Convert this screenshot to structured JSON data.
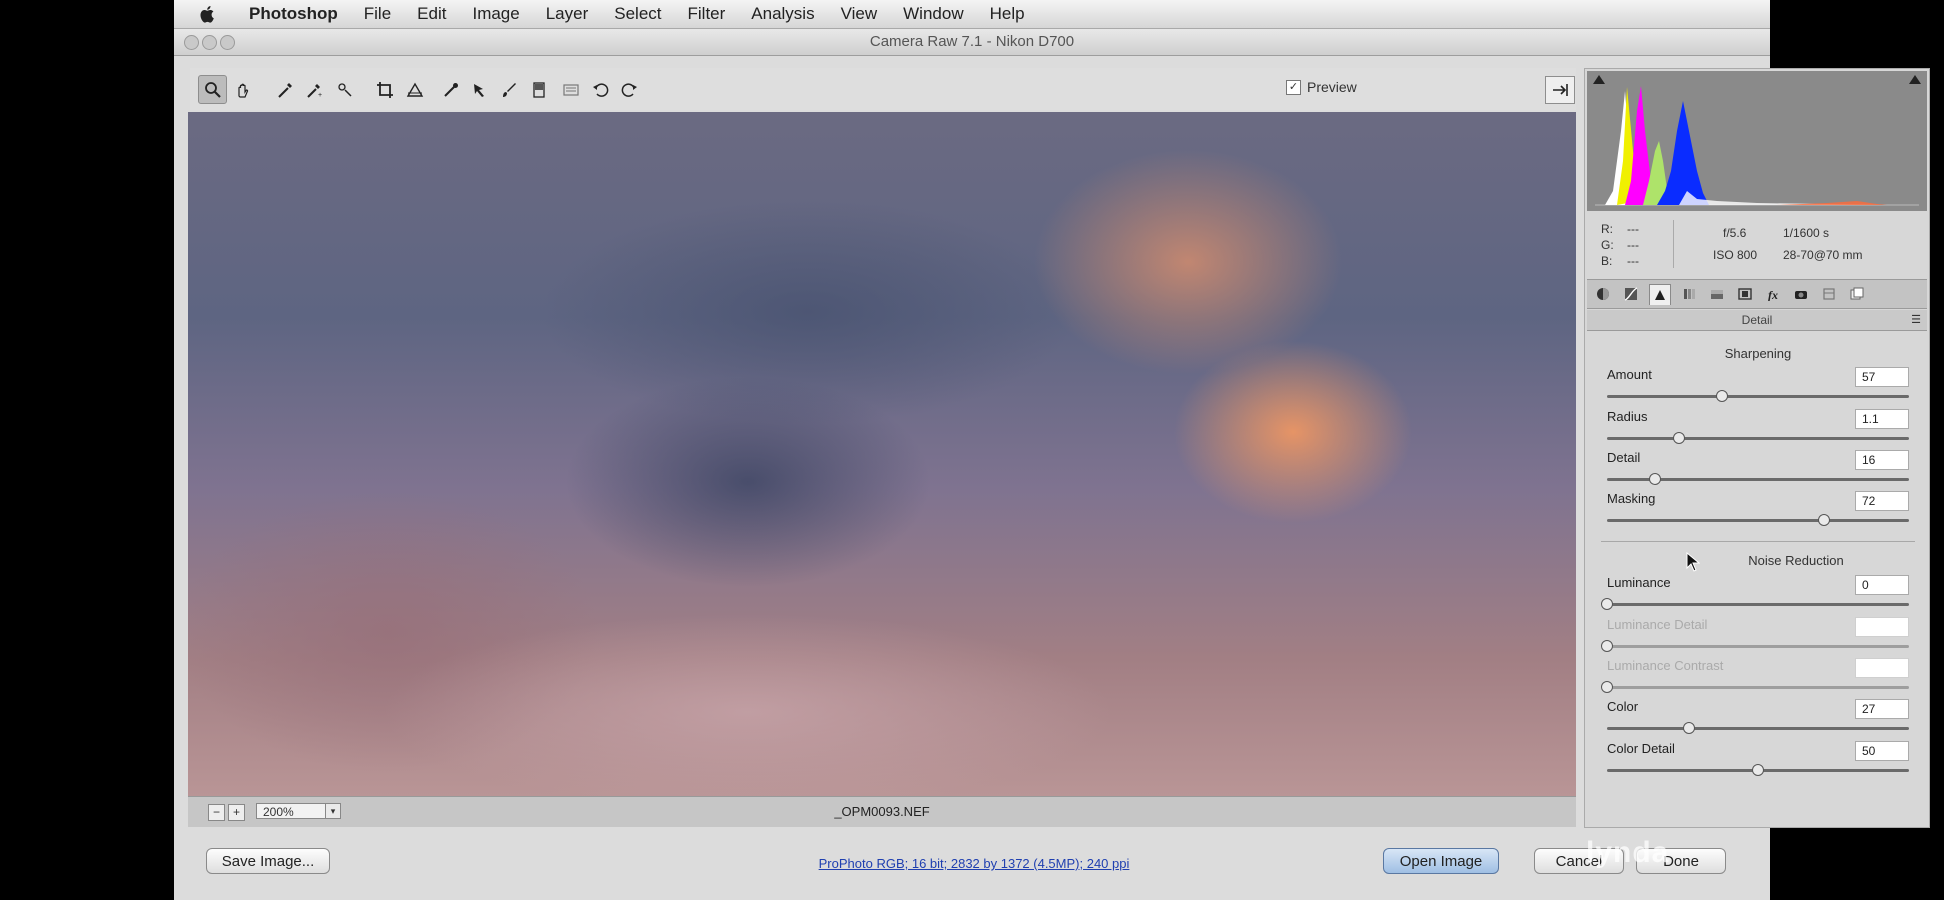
{
  "menubar": {
    "items": [
      "Photoshop",
      "File",
      "Edit",
      "Image",
      "Layer",
      "Select",
      "Filter",
      "Analysis",
      "View",
      "Window",
      "Help"
    ]
  },
  "window": {
    "title": "Camera Raw 7.1  -  Nikon D700"
  },
  "toolbar": {
    "tools": [
      "zoom-tool",
      "hand-tool",
      "white-balance-tool",
      "color-sampler-tool",
      "targeted-adjustment-tool",
      "crop-tool",
      "straighten-tool",
      "spot-removal-tool",
      "red-eye-removal-tool",
      "adjustment-brush-tool",
      "graduated-filter-tool",
      "preferences-tool",
      "rotate-ccw-tool",
      "rotate-cw-tool"
    ],
    "preview_label": "Preview",
    "preview_checked": true
  },
  "image": {
    "zoom": "200%",
    "filename": "_OPM0093.NEF"
  },
  "info": {
    "r_label": "R:",
    "g_label": "G:",
    "b_label": "B:",
    "r_value": "---",
    "g_value": "---",
    "b_value": "---",
    "aperture": "f/5.6",
    "shutter": "1/1600 s",
    "iso": "ISO 800",
    "lens": "28-70@70 mm"
  },
  "panel": {
    "title": "Detail",
    "sharpening": {
      "title": "Sharpening",
      "sliders": [
        {
          "label": "Amount",
          "value": "57",
          "level": 0.38
        },
        {
          "label": "Radius",
          "value": "1.1",
          "level": 0.24
        },
        {
          "label": "Detail",
          "value": "16",
          "level": 0.16
        },
        {
          "label": "Masking",
          "value": "72",
          "level": 0.72
        }
      ]
    },
    "noise_reduction": {
      "title": "Noise Reduction",
      "sliders": [
        {
          "label": "Luminance",
          "value": "0",
          "level": 0.0,
          "enabled": true
        },
        {
          "label": "Luminance Detail",
          "value": "",
          "level": 0.0,
          "enabled": false
        },
        {
          "label": "Luminance Contrast",
          "value": "",
          "level": 0.0,
          "enabled": false
        },
        {
          "label": "Color",
          "value": "27",
          "level": 0.27,
          "enabled": true
        },
        {
          "label": "Color Detail",
          "value": "50",
          "level": 0.5,
          "enabled": true
        }
      ]
    }
  },
  "footer": {
    "save_label": "Save Image...",
    "workflow_text": "ProPhoto RGB; 16 bit; 2832 by 1372 (4.5MP); 240 ppi",
    "open_label": "Open Image",
    "cancel_label": "Cancel",
    "done_label": "Done"
  },
  "watermark": "lynda",
  "colors": {
    "chrome": "#dcdcdc",
    "histogram_bg": "#8a8a8a",
    "link": "#1f3fb0",
    "default_button": "#9fbfe4"
  }
}
